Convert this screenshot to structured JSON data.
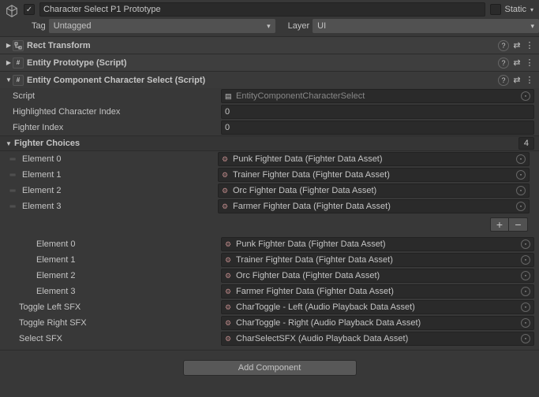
{
  "header": {
    "object_name": "Character Select P1 Prototype",
    "enabled": true,
    "static_label": "Static",
    "static_checked": false,
    "tag_label": "Tag",
    "tag_value": "Untagged",
    "layer_label": "Layer",
    "layer_value": "UI"
  },
  "components": {
    "rect_transform": {
      "title": "Rect Transform"
    },
    "entity_prototype": {
      "title": "Entity Prototype (Script)"
    },
    "char_select": {
      "title": "Entity Component Character Select (Script)",
      "script_label": "Script",
      "script_value": "EntityComponentCharacterSelect",
      "highlighted_label": "Highlighted Character Index",
      "highlighted_value": "0",
      "fighter_index_label": "Fighter Index",
      "fighter_index_value": "0",
      "fighter_choices_label": "Fighter Choices",
      "fighter_choices_size": "4",
      "fighter_choices": [
        {
          "label": "Element 0",
          "value": "Punk Fighter Data (Fighter Data Asset)"
        },
        {
          "label": "Element 1",
          "value": "Trainer Fighter Data (Fighter Data Asset)"
        },
        {
          "label": "Element 2",
          "value": "Orc Fighter Data (Fighter Data Asset)"
        },
        {
          "label": "Element 3",
          "value": "Farmer Fighter Data (Fighter Data Asset)"
        }
      ],
      "flat_elements": [
        {
          "label": "Element 0",
          "value": "Punk Fighter Data (Fighter Data Asset)"
        },
        {
          "label": "Element 1",
          "value": "Trainer Fighter Data (Fighter Data Asset)"
        },
        {
          "label": "Element 2",
          "value": "Orc Fighter Data (Fighter Data Asset)"
        },
        {
          "label": "Element 3",
          "value": "Farmer Fighter Data (Fighter Data Asset)"
        }
      ],
      "toggle_left_label": "Toggle Left SFX",
      "toggle_left_value": "CharToggle - Left (Audio Playback Data Asset)",
      "toggle_right_label": "Toggle Right SFX",
      "toggle_right_value": "CharToggle - Right (Audio Playback Data Asset)",
      "select_sfx_label": "Select SFX",
      "select_sfx_value": "CharSelectSFX (Audio Playback Data Asset)"
    }
  },
  "footer": {
    "add_component": "Add Component"
  }
}
